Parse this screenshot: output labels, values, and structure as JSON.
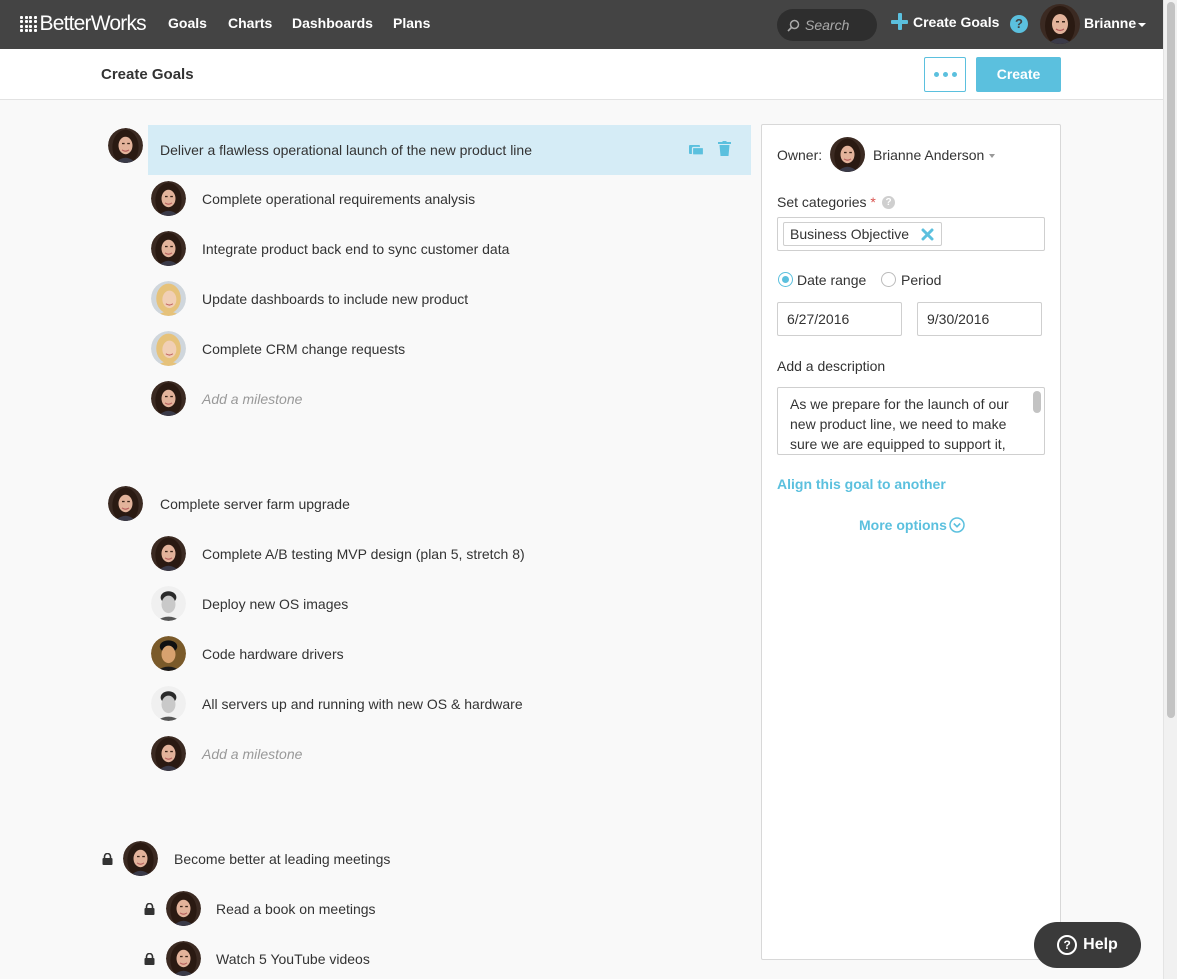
{
  "nav": {
    "logo": "BetterWorks",
    "items": [
      "Goals",
      "Charts",
      "Dashboards",
      "Plans"
    ],
    "search_placeholder": "Search",
    "create_goals": "Create Goals",
    "help": "?",
    "user": "Brianne"
  },
  "header": {
    "title": "Create Goals",
    "create_label": "Create"
  },
  "goals": [
    {
      "title": "Deliver a flawless operational launch of the new product line",
      "milestones": [
        "Complete operational requirements analysis",
        "Integrate product back end to sync customer data",
        "Update dashboards to include new product",
        "Complete CRM change requests"
      ],
      "add_milestone": "Add a milestone"
    },
    {
      "title": "Complete server farm upgrade",
      "milestones": [
        "Complete A/B testing MVP design (plan 5, stretch 8)",
        "Deploy new OS images",
        "Code hardware drivers",
        "All servers up and running with new OS & hardware"
      ],
      "add_milestone": "Add a milestone"
    },
    {
      "title": "Become better at leading meetings",
      "milestones": [
        "Read a book on meetings",
        "Watch 5 YouTube videos"
      ]
    }
  ],
  "panel": {
    "owner_label": "Owner:",
    "owner_name": "Brianne Anderson",
    "categories_label": "Set categories",
    "required_mark": "*",
    "hint": "?",
    "category_tag": "Business Objective",
    "date_range_label": "Date range",
    "period_label": "Period",
    "start_date": "6/27/2016",
    "end_date": "9/30/2016",
    "description_label": "Add a description",
    "description": "As we prepare for the launch of our new product line, we need to make sure we are equipped to support it,",
    "align_link": "Align this goal to another",
    "more_options": "More options"
  },
  "help_button": "Help",
  "colors": {
    "accent": "#5bc0de",
    "nav_bg": "#444444",
    "selected_row": "#d5ecf6"
  }
}
